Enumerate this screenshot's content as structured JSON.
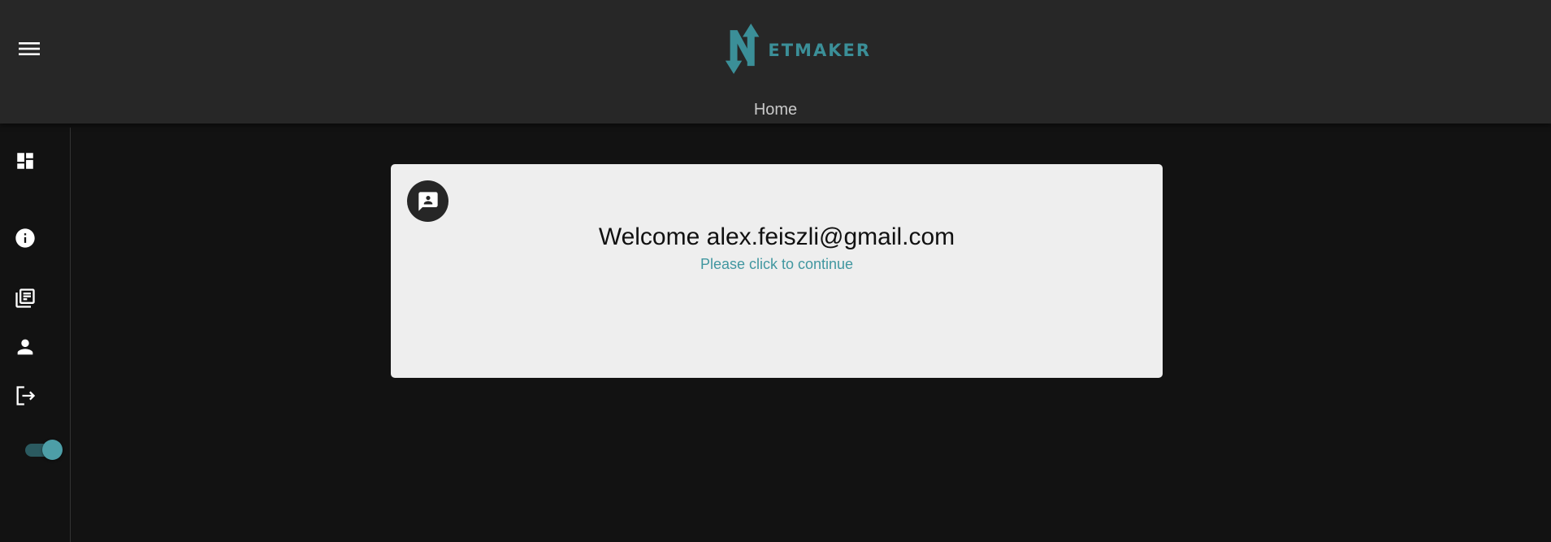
{
  "header": {
    "logo": {
      "letter": "N",
      "text": "ETMAKER"
    },
    "page_title": "Home",
    "menu_icon": "hamburger-menu-icon"
  },
  "sidebar": {
    "items": [
      {
        "icon": "dashboard-icon"
      },
      {
        "icon": "info-icon"
      },
      {
        "icon": "library-books-icon"
      },
      {
        "icon": "person-icon"
      },
      {
        "icon": "logout-icon"
      }
    ],
    "theme_toggle": {
      "checked": true
    }
  },
  "main": {
    "card": {
      "avatar_icon": "contact-message-icon",
      "title": "Welcome alex.feiszli@gmail.com",
      "subtitle": "Please click to continue"
    }
  },
  "colors": {
    "accent": "#3b8f98",
    "appbar": "#272727",
    "background": "#121212",
    "card": "#eeeeee"
  }
}
